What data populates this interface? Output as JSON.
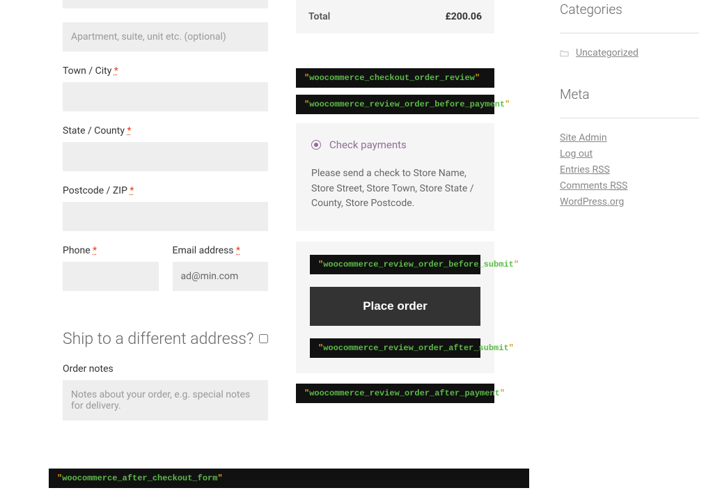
{
  "form": {
    "apt_placeholder": "Apartment, suite, unit etc. (optional)",
    "town_label": "Town / City",
    "state_label": "State / County",
    "postcode_label": "Postcode / ZIP",
    "phone_label": "Phone",
    "email_label": "Email address",
    "email_value": "ad@min.com",
    "required_mark": "*",
    "ship_heading": "Ship to a different address?",
    "notes_label": "Order notes",
    "notes_placeholder": "Notes about your order, e.g. special notes for delivery."
  },
  "order": {
    "total_label": "Total",
    "total_value": "£200.06",
    "payment_method": "Check payments",
    "payment_desc": "Please send a check to Store Name, Store Street, Store Town, Store State / County, Store Postcode.",
    "place_order_label": "Place order"
  },
  "hooks": {
    "checkout_order_review": "woocommerce_checkout_order_review",
    "review_before_payment": "woocommerce_review_order_before_payment",
    "review_before_submit": "woocommerce_review_order_before_submit",
    "review_after_submit": "woocommerce_review_order_after_submit",
    "review_after_payment": "woocommerce_review_order_after_payment",
    "after_checkout_form": "woocommerce_after_checkout_form"
  },
  "sidebar": {
    "categories_heading": "Categories",
    "uncategorized": "Uncategorized",
    "meta_heading": "Meta",
    "links": {
      "site_admin": "Site Admin",
      "logout": "Log out",
      "entries_prefix": "Entries ",
      "entries_rss": "RSS",
      "comments_prefix": "Comments ",
      "comments_rss": "RSS",
      "wp_org": "WordPress.org"
    }
  }
}
